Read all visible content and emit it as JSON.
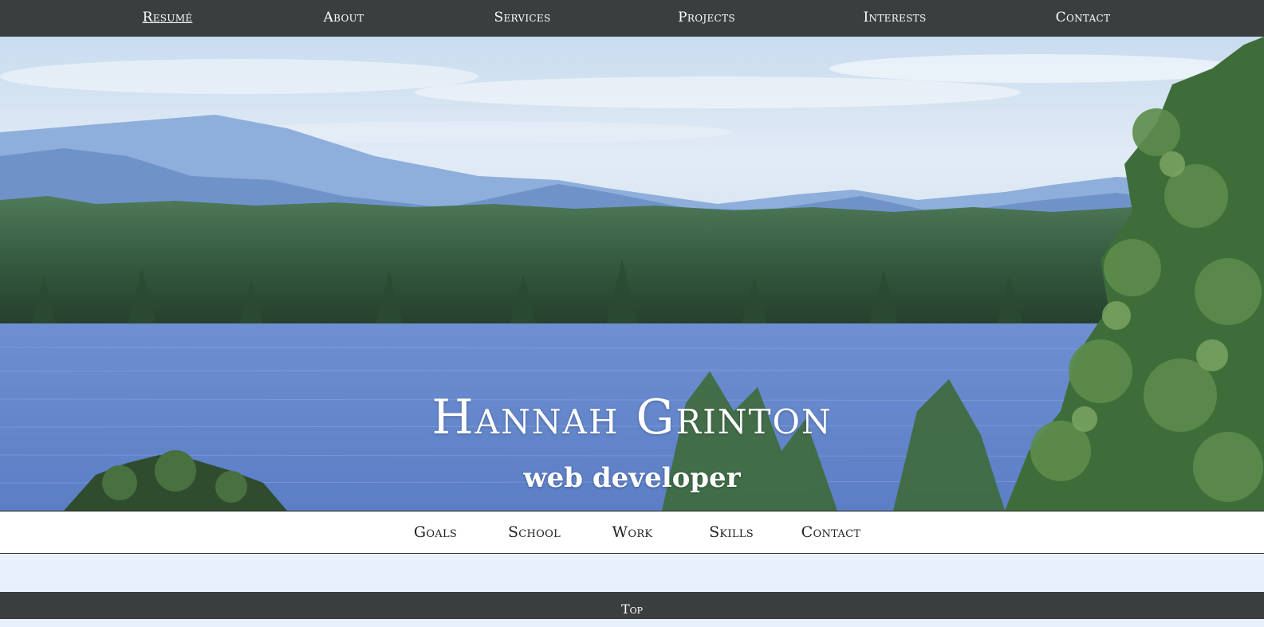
{
  "top_nav": {
    "items": [
      {
        "label": "Resumé",
        "active": true
      },
      {
        "label": "About",
        "active": false
      },
      {
        "label": "Services",
        "active": false
      },
      {
        "label": "Projects",
        "active": false
      },
      {
        "label": "Interests",
        "active": false
      },
      {
        "label": "Contact",
        "active": false
      }
    ]
  },
  "hero": {
    "title": "Hannah Grinton",
    "subtitle": "web developer"
  },
  "sub_nav": {
    "items": [
      {
        "label": "Goals"
      },
      {
        "label": "School"
      },
      {
        "label": "Work"
      },
      {
        "label": "Skills"
      },
      {
        "label": "Contact"
      }
    ]
  },
  "footer": {
    "top_link": "Top"
  },
  "colors": {
    "nav_bg": "#3a3e3e",
    "nav_text": "#ffffff",
    "content_bg": "#e8f1fb",
    "sub_nav_bg": "#ffffff"
  }
}
